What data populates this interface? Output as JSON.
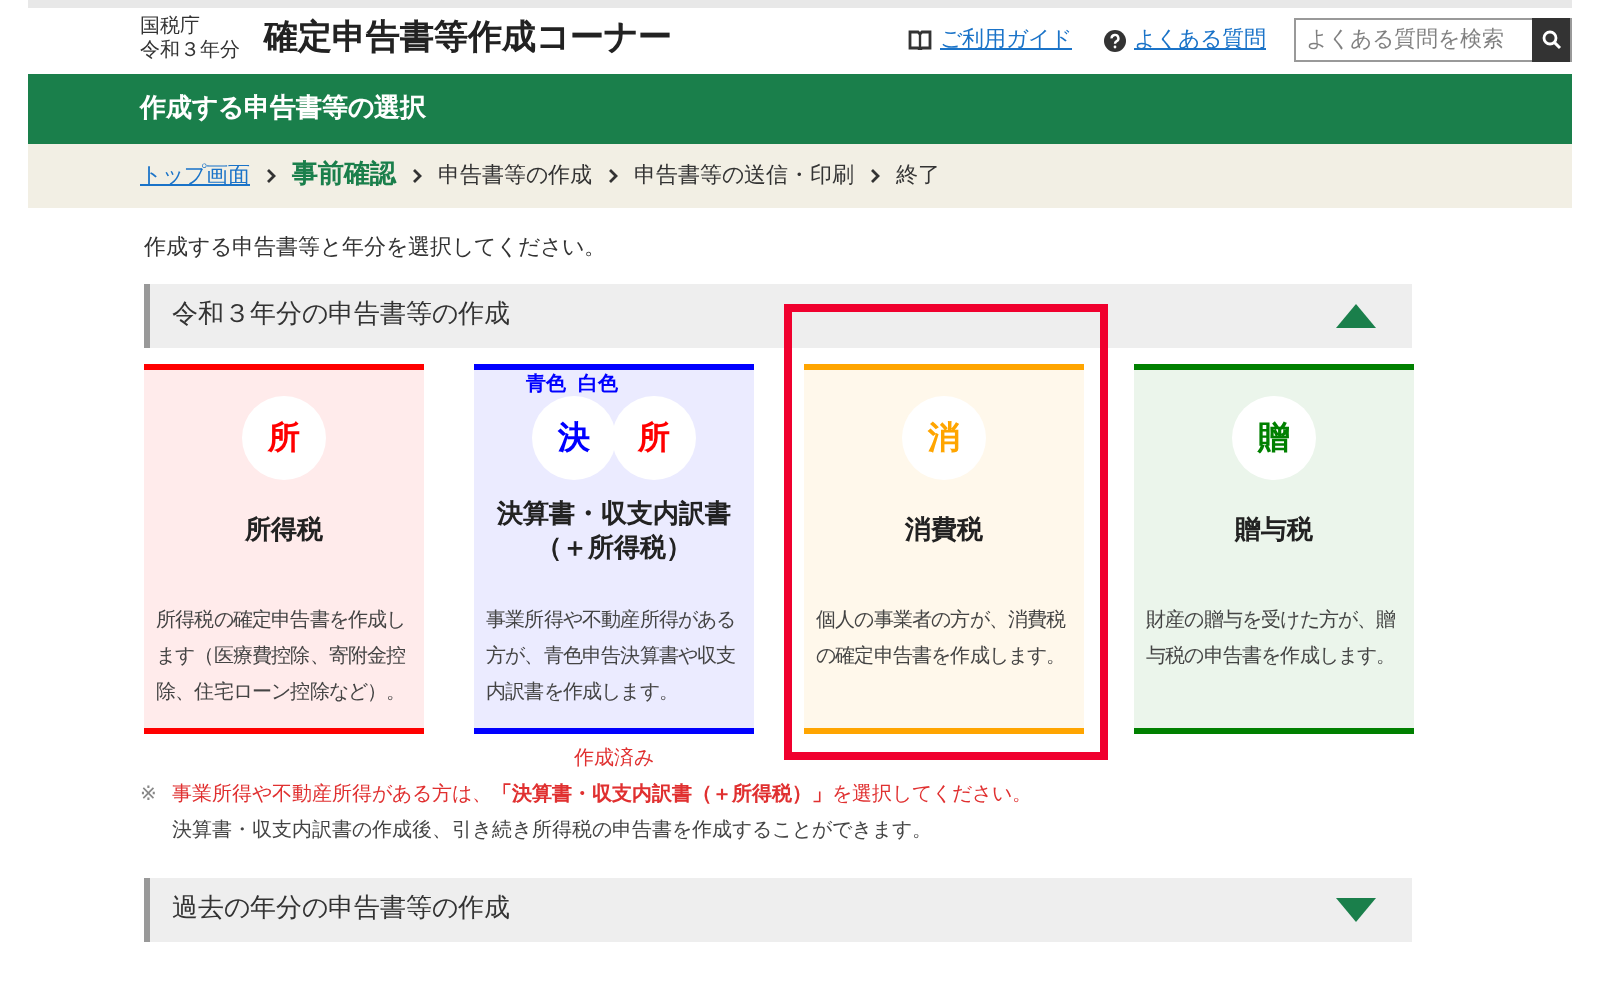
{
  "header": {
    "agency": "国税庁",
    "year": "令和３年分",
    "title": "確定申告書等作成コーナー",
    "links": [
      {
        "label": "ご利用ガイド"
      },
      {
        "label": "よくある質問"
      }
    ],
    "search": {
      "placeholder": "よくある質問を検索"
    }
  },
  "banner": {
    "title": "作成する申告書等の選択"
  },
  "breadcrumb": [
    {
      "label": "トップ画面",
      "kind": "link"
    },
    {
      "label": "事前確認",
      "kind": "current"
    },
    {
      "label": "申告書等の作成",
      "kind": "plain"
    },
    {
      "label": "申告書等の送信・印刷",
      "kind": "plain"
    },
    {
      "label": "終了",
      "kind": "plain"
    }
  ],
  "instruction": "作成する申告書等と年分を選択してください。",
  "sections": [
    {
      "title": "令和３年分の申告書等の作成",
      "expanded": true,
      "cards": [
        {
          "badges": [
            {
              "char": "所",
              "color": "#ff0000"
            }
          ],
          "title": "所得税",
          "description": "所得税の確定申告書を作成します（医療費控除、寄附金控除、住宅ローン控除など）。",
          "color": "#ff0000",
          "selected": false
        },
        {
          "badges": [
            {
              "char": "決",
              "color": "#0000ff",
              "captions": [
                "青色",
                "白色"
              ]
            },
            {
              "char": "所",
              "color": "#ff0000"
            }
          ],
          "title": "決算書・収支内訳書（＋所得税）",
          "description": "事業所得や不動産所得がある方が、青色申告決算書や収支内訳書を作成します。",
          "color": "#0000ff",
          "status": "作成済み",
          "selected": false
        },
        {
          "badges": [
            {
              "char": "消",
              "color": "#ffa500"
            }
          ],
          "title": "消費税",
          "description": "個人の事業者の方が、消費税の確定申告書を作成します。",
          "color": "#ffa500",
          "selected": true
        },
        {
          "badges": [
            {
              "char": "贈",
              "color": "#008000"
            }
          ],
          "title": "贈与税",
          "description": "財産の贈与を受けた方が、贈与税の申告書を作成します。",
          "color": "#008000",
          "selected": false
        }
      ],
      "notes": [
        {
          "mark": "※",
          "text": "事業所得や不動産所得がある方は、**「決算書・収支内訳書（＋所得税）」**を選択してください。",
          "kind": "warning"
        },
        {
          "text": "決算書・収支内訳書の作成後、引き続き所得税の申告書を作成することができます。",
          "kind": "info"
        }
      ]
    },
    {
      "title": "過去の年分の申告書等の作成",
      "expanded": false
    }
  ]
}
